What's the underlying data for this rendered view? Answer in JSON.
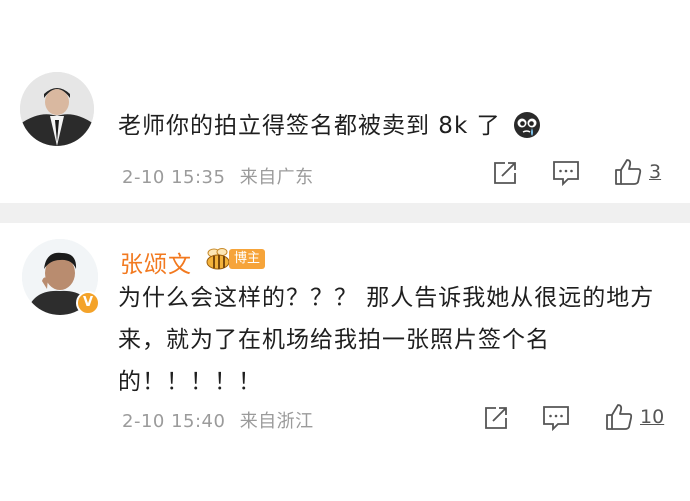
{
  "comments": [
    {
      "text": "老师你的拍立得签名都被卖到 8k 了",
      "emoji": "crying-face-icon",
      "time": "2-10 15:35",
      "location": "来自广东",
      "likes": "3"
    },
    {
      "author": "张颂文",
      "badge": "博主",
      "text": "为什么会这样的？？？ 那人告诉我她从很远的地方来，就为了在机场给我拍一张照片签个名的！！！！！",
      "time": "2-10 15:40",
      "location": "来自浙江",
      "likes": "10",
      "verified": "V"
    }
  ],
  "colors": {
    "author": "#f2791f",
    "badge": "#f6a43a",
    "meta": "#9b9b9b",
    "divider": "#f0f0f0"
  }
}
